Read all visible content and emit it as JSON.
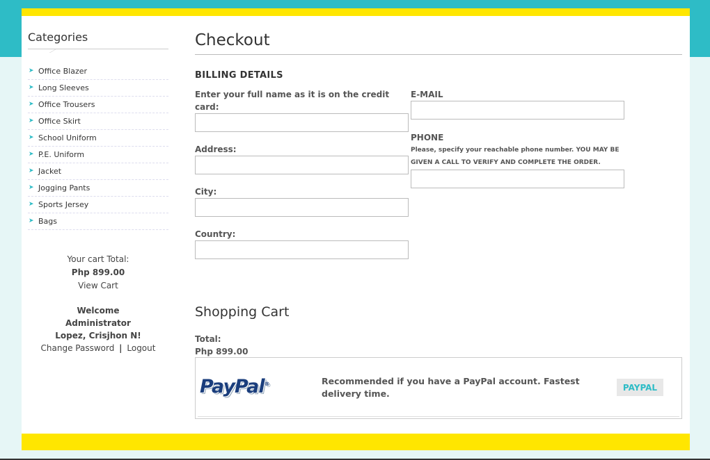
{
  "sidebar": {
    "title": "Categories",
    "categories": [
      "Office Blazer",
      "Long Sleeves",
      "Office Trousers",
      "Office Skirt",
      "School Uniform",
      "P.E. Uniform",
      "Jacket",
      "Jogging Pants",
      "Sports Jersey",
      "Bags"
    ],
    "cart_label": "Your cart Total:",
    "cart_total": "Php 899.00",
    "view_cart": "View Cart",
    "welcome": "Welcome",
    "role": "Administrator",
    "user_name": "Lopez, Crisjhon N!",
    "change_password": "Change Password",
    "separator": "|",
    "logout": "Logout"
  },
  "main": {
    "title": "Checkout",
    "billing_heading": "BILLING DETAILS",
    "fields": {
      "name_label": "Enter your full name as it is on the credit card:",
      "address_label": "Address:",
      "city_label": "City:",
      "country_label": "Country:",
      "email_label": "E-MAIL",
      "phone_label": "PHONE",
      "phone_note": "Please, specify your reachable phone number. YOU MAY BE GIVEN A CALL TO VERIFY AND COMPLETE THE ORDER."
    },
    "cart_heading": "Shopping Cart",
    "total_label": "Total:",
    "total_value": "Php 899.00",
    "payment": {
      "logo_text": "PayPal",
      "logo_mark": "®",
      "description": "Recommended if you have a PayPal account. Fastest delivery time.",
      "button_label": "PAYPAL"
    }
  },
  "colors": {
    "accent_teal": "#2ebcc6",
    "accent_yellow": "#ffe600",
    "paypal_blue": "#1a3d7c"
  }
}
